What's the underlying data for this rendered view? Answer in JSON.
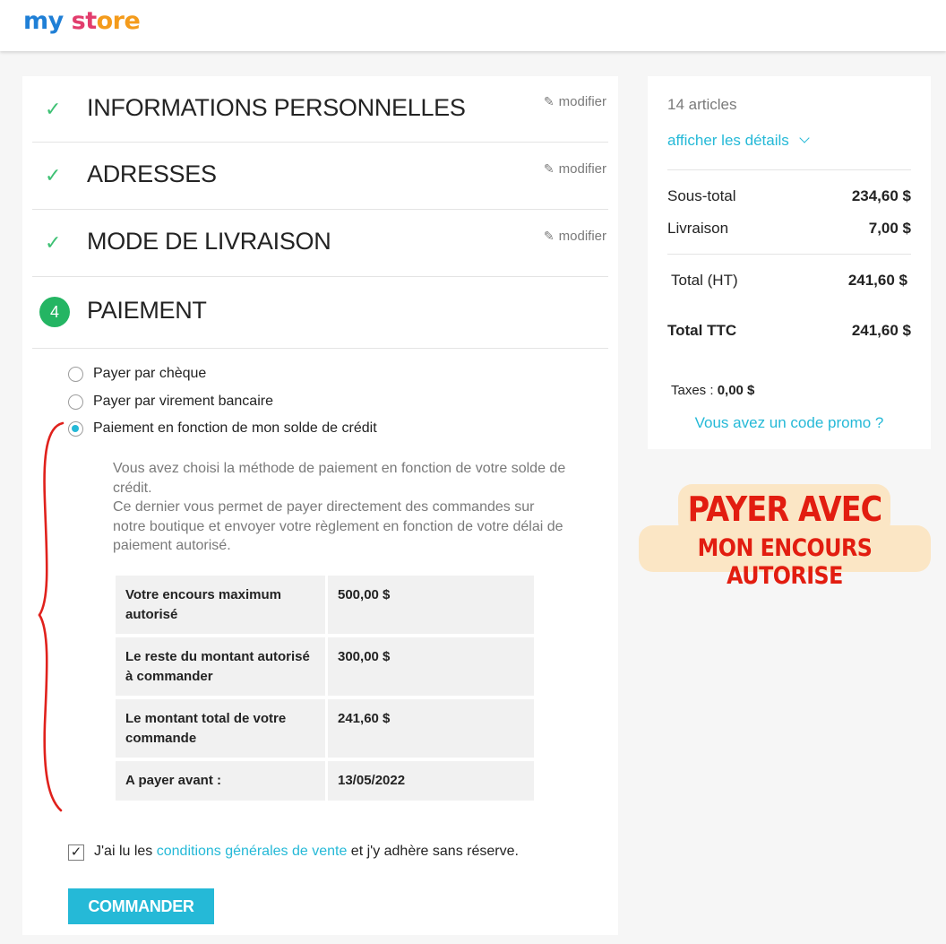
{
  "logo": {
    "part1": "my",
    "part2": " ",
    "part3": "st",
    "part4": "ore"
  },
  "steps": [
    {
      "title": "INFORMATIONS PERSONNELLES",
      "edit": "modifier"
    },
    {
      "title": "ADRESSES",
      "edit": "modifier"
    },
    {
      "title": "MODE DE LIVRAISON",
      "edit": "modifier"
    },
    {
      "number": "4",
      "title": "PAIEMENT"
    }
  ],
  "payment_options": [
    {
      "label": "Payer par chèque",
      "selected": false
    },
    {
      "label": "Payer par virement bancaire",
      "selected": false
    },
    {
      "label": "Paiement en fonction de mon solde de crédit",
      "selected": true
    }
  ],
  "description": {
    "line1": "Vous avez choisi la méthode de paiement en fonction de votre solde de crédit.",
    "line2": "Ce dernier vous permet de payer directement des commandes sur notre boutique et envoyer votre règlement en fonction de votre délai de paiement autorisé."
  },
  "credit_table": [
    {
      "label": "Votre encours maximum autorisé",
      "value": "500,00 $"
    },
    {
      "label": "Le reste du montant autorisé à commander",
      "value": "300,00 $"
    },
    {
      "label": "Le montant total de votre commande",
      "value": "241,60 $"
    },
    {
      "label": "A payer avant :",
      "value": "13/05/2022"
    }
  ],
  "terms": {
    "prefix": "J'ai lu les ",
    "link": "conditions générales de vente",
    "suffix": " et j'y adhère sans réserve.",
    "checked": true
  },
  "order_button": "COMMANDER",
  "summary": {
    "articles": "14 articles",
    "details_link": "afficher les détails",
    "subtotal_label": "Sous-total",
    "subtotal_value": "234,60 $",
    "shipping_label": "Livraison",
    "shipping_value": "7,00 $",
    "total_ht_label": "Total (HT)",
    "total_ht_value": "241,60 $",
    "total_ttc_label": "Total TTC",
    "total_ttc_value": "241,60 $",
    "taxes_label": "Taxes : ",
    "taxes_value": "0,00 $",
    "promo_link": "Vous avez un code promo ?"
  },
  "badge": {
    "line1": "PAYER AVEC",
    "line2": "MON ENCOURS AUTORISE"
  },
  "colors": {
    "accent": "#25b9d7",
    "success": "#24b563",
    "badge_text": "#e21d10",
    "badge_bg": "#fbe6c5"
  }
}
